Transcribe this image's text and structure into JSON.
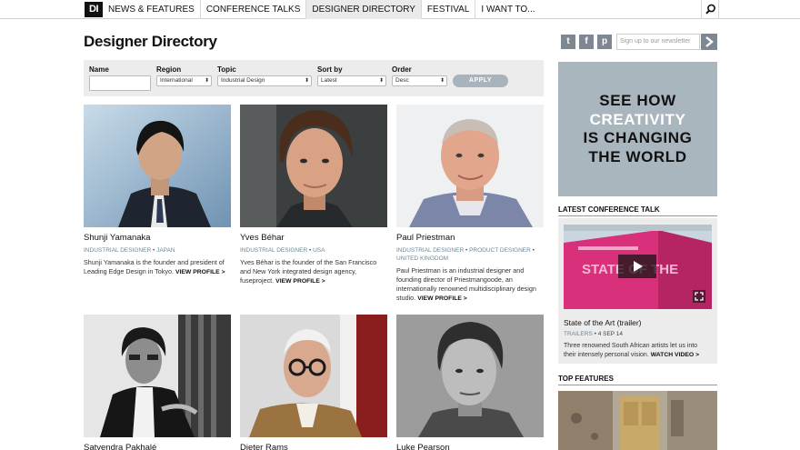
{
  "nav": {
    "logo": "DI",
    "items": [
      "NEWS & FEATURES",
      "CONFERENCE TALKS",
      "DESIGNER DIRECTORY",
      "FESTIVAL",
      "I WANT TO..."
    ],
    "active_index": 2
  },
  "page_title": "Designer Directory",
  "social": {
    "twitter": "t",
    "facebook": "f",
    "pinterest": "p"
  },
  "newsletter": {
    "placeholder": "Sign up to our newsletter"
  },
  "filters": {
    "name_label": "Name",
    "name_value": "",
    "region_label": "Region",
    "region_value": "International",
    "topic_label": "Topic",
    "topic_value": "Industrial Design",
    "sortby_label": "Sort by",
    "sortby_value": "Latest",
    "order_label": "Order",
    "order_value": "Desc",
    "apply_label": "APPLY"
  },
  "designers": [
    {
      "name": "Shunji Yamanaka",
      "tags": [
        "INDUSTRIAL DESIGNER",
        "JAPAN"
      ],
      "desc": "Shunji Yamanaka is the founder and president of Leading Edge Design in Tokyo.",
      "link": "VIEW PROFILE >"
    },
    {
      "name": "Yves Béhar",
      "tags": [
        "INDUSTRIAL DESIGNER",
        "USA"
      ],
      "desc": "Yves Béhar is the founder of the San Francisco and New York integrated design agency, fuseproject.",
      "link": "VIEW PROFILE >"
    },
    {
      "name": "Paul Priestman",
      "tags": [
        "INDUSTRIAL DESIGNER",
        "PRODUCT DESIGNER",
        "UNITED KINGDOM"
      ],
      "desc": "Paul Priestman is an industrial designer and founding director of Priestmangoode, an internationally renowned multidisciplinary design studio.",
      "link": "VIEW PROFILE >"
    },
    {
      "name": "Satyendra Pakhalé"
    },
    {
      "name": "Dieter Rams"
    },
    {
      "name": "Luke Pearson"
    }
  ],
  "ad": {
    "line1": "SEE HOW",
    "line2": "CREATIVITY",
    "line3": "IS CHANGING",
    "line4": "THE WORLD"
  },
  "latest_talk": {
    "heading": "LATEST CONFERENCE TALK",
    "title": "State of the Art (trailer)",
    "category": "TRAILERS",
    "date": "4 SEP 14",
    "desc": "Three renowned South African artists let us into their intensely personal vision.",
    "link": "WATCH VIDEO >",
    "thumb_text": "STATE OF THE"
  },
  "top_features": {
    "heading": "TOP FEATURES"
  },
  "colors": {
    "accent": "#6d8696",
    "ad_bg": "#a9b6be",
    "talk_pink": "#d8307a"
  }
}
